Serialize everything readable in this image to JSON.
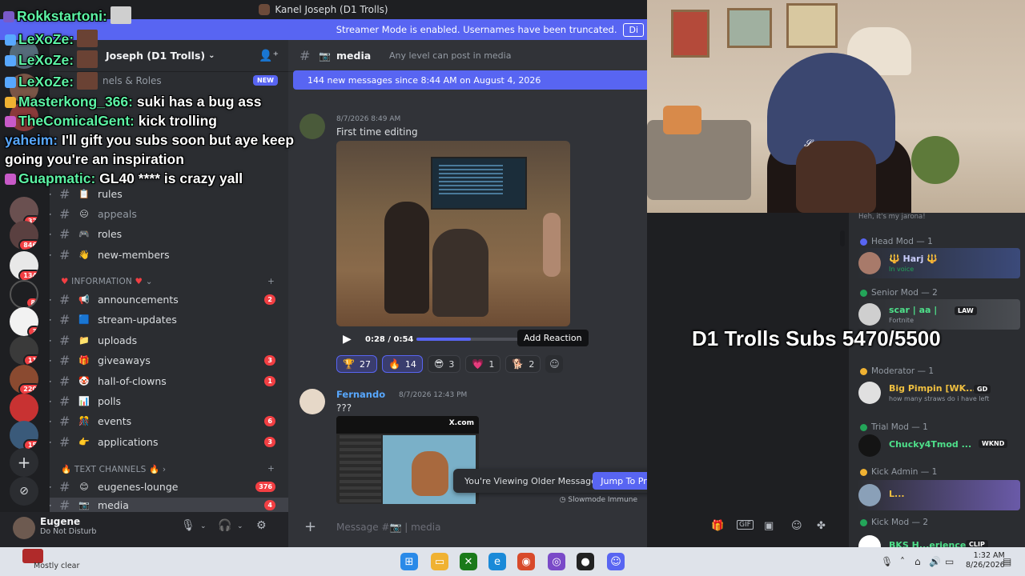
{
  "window": {
    "title": "Kanel Joseph (D1 Trolls)",
    "streamer_banner": "Streamer Mode is enabled. Usernames have been truncated.",
    "streamer_banner_button": "Di"
  },
  "server": {
    "name": "Joseph (D1 Trolls)",
    "roles_link": "nels & Roles",
    "new_badge": "NEW"
  },
  "guild_badges": [
    "32",
    "846",
    "134",
    "8",
    "3",
    "11",
    "220",
    "15"
  ],
  "channels": [
    {
      "emoji": "📋",
      "name": "rules",
      "count": ""
    },
    {
      "emoji": "😐",
      "name": "appeals",
      "count": ""
    },
    {
      "emoji": "🎮",
      "name": "roles",
      "count": ""
    },
    {
      "emoji": "👋",
      "name": "new-members",
      "count": ""
    }
  ],
  "category_info": "INFORMATION",
  "info_channels": [
    {
      "emoji": "📢",
      "name": "announcements",
      "count": "2"
    },
    {
      "emoji": "🟦",
      "name": "stream-updates",
      "count": ""
    },
    {
      "emoji": "📁",
      "name": "uploads",
      "count": ""
    },
    {
      "emoji": "🎁",
      "name": "giveaways",
      "count": "3"
    },
    {
      "emoji": "🤡",
      "name": "hall-of-clowns",
      "count": "1"
    },
    {
      "emoji": "📊",
      "name": "polls",
      "count": ""
    },
    {
      "emoji": "🎊",
      "name": "events",
      "count": "6"
    },
    {
      "emoji": "👉",
      "name": "applications",
      "count": "3"
    }
  ],
  "category_text": "TEXT CHANNELS",
  "text_channels": [
    {
      "emoji": "😊",
      "name": "eugenes-lounge",
      "count": "376"
    },
    {
      "emoji": "📷",
      "name": "media",
      "count": "4"
    }
  ],
  "user": {
    "name": "Eugene",
    "status": "Do Not Disturb"
  },
  "chat": {
    "channel": "media",
    "topic": "Any level can post in media",
    "new_messages": "144 new messages since 8:44 AM on August 4, 2026",
    "msg1_time": "8/7/2026 8:49 AM",
    "msg1_text": "First time editing",
    "video_time": "0:28 / 0:54",
    "video_progress": 0.52,
    "add_reaction": "Add Reaction",
    "reactions": [
      {
        "emoji": "🏆",
        "count": "27",
        "me": true
      },
      {
        "emoji": "🔥",
        "count": "14",
        "me": true
      },
      {
        "emoji": "😎",
        "count": "3",
        "me": false
      },
      {
        "emoji": "💗",
        "count": "1",
        "me": false
      },
      {
        "emoji": "🐕",
        "count": "2",
        "me": false
      }
    ],
    "msg2_author": "Fernando",
    "msg2_time": "8/7/2026 12:43 PM",
    "msg2_text": "???",
    "tweet_site": "X.com",
    "older_text": "You're Viewing Older Messages",
    "jump_button": "Jump To Present",
    "slowmode": "Slowmode Immune",
    "composer_placeholder": "Message #📷 | media"
  },
  "members": {
    "top_text": "Heh, it's my jarona!",
    "roles": [
      {
        "label": "Head Mod — 1",
        "color": "#5865f2"
      },
      {
        "label": "Senior Mod — 2",
        "color": "#23a559"
      },
      {
        "label": "Moderator — 1",
        "color": "#f0b232"
      },
      {
        "label": "Trial Mod — 1",
        "color": "#23a559"
      },
      {
        "label": "Kick Admin — 1",
        "color": "#f0b232"
      },
      {
        "label": "Kick Mod — 2",
        "color": "#23a559"
      }
    ],
    "list": [
      {
        "name": "🔱 Harj 🔱",
        "sub": "In voice",
        "tag": "",
        "color": "#c9cdfb"
      },
      {
        "name": "scar | aa |",
        "sub": "Fortnite",
        "tag": "LAW",
        "color": "#4ee08a"
      },
      {
        "name": "Big Pimpin [WK...",
        "sub": "how many straws do i have left",
        "tag": "GD",
        "color": "#f0c040"
      },
      {
        "name": "Chucky4Tmod ...",
        "sub": "",
        "tag": "WKND",
        "color": "#4ee08a"
      },
      {
        "name": "L...",
        "sub": "",
        "tag": "",
        "color": "#f0c040"
      },
      {
        "name": "BKS H...erience",
        "sub": "",
        "tag": "CLIP",
        "color": "#4ee08a"
      }
    ]
  },
  "overlay": {
    "subs": "D1 Trolls Subs 5470/5500",
    "chat_lines": [
      {
        "name": "Rokkstartoni:",
        "text": ""
      },
      {
        "name": "LeXoZe:",
        "text": ""
      },
      {
        "name": "LeXoZe:",
        "text": ""
      },
      {
        "name": "LeXoZe:",
        "text": ""
      },
      {
        "name": "Masterkong_366:",
        "text": " suki has a bug ass"
      },
      {
        "name": "TheComicalGent:",
        "text": " kick trolling"
      },
      {
        "name": "yaheim:",
        "text": " I'll gift you subs soon but aye keep"
      },
      {
        "name": "",
        "text": "going you're an inspiration"
      },
      {
        "name": "Guapmatic:",
        "text": " GL40 **** is crazy yall"
      }
    ]
  },
  "taskbar": {
    "weather": "Mostly clear",
    "time": "1:32 AM",
    "date": "8/26/2026"
  }
}
